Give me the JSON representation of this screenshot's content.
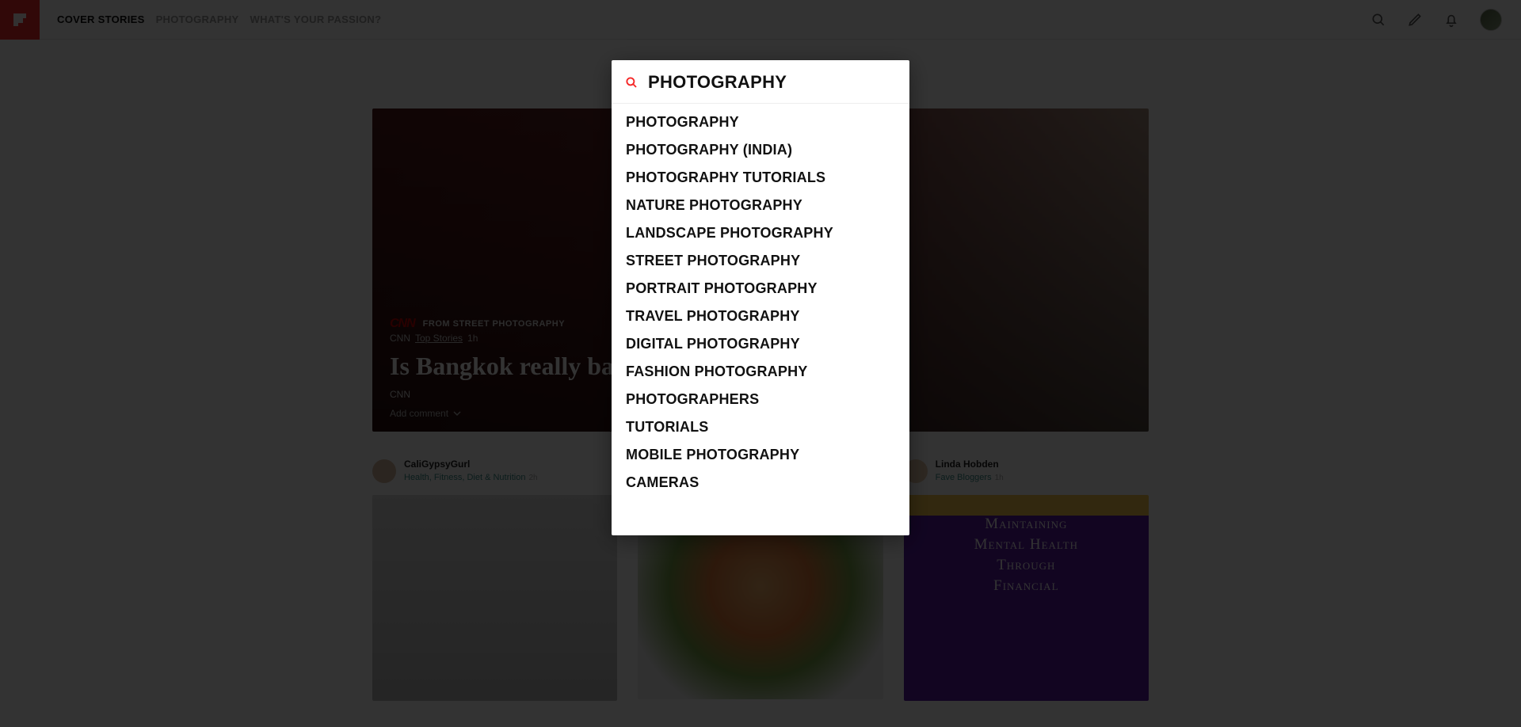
{
  "header": {
    "tabs": [
      "COVER STORIES",
      "PHOTOGRAPHY",
      "WHAT'S YOUR PASSION?"
    ],
    "active_tab": 0
  },
  "hero": {
    "kicker": "FROM STREET PHOTOGRAPHY",
    "source_short": "CNN",
    "source_section": "Top Stories",
    "age": "1h",
    "title": "Is Bangkok really banning its street food stalls?",
    "source": "CNN",
    "add_comment": "Add comment"
  },
  "cards": [
    {
      "author": "CaliGypsyGurl",
      "sub": "Health, Fitness, Diet & Nutrition",
      "age": "2h"
    },
    {
      "author": "",
      "sub": "",
      "age": ""
    },
    {
      "author": "Linda Hobden",
      "sub": "Fave Bloggers",
      "age": "1h",
      "tile_lines": [
        "Maintaining",
        "Mental Health",
        "Through",
        "Financial"
      ]
    }
  ],
  "search": {
    "query": "PHOTOGRAPHY",
    "suggestions": [
      "PHOTOGRAPHY",
      "PHOTOGRAPHY (INDIA)",
      "PHOTOGRAPHY TUTORIALS",
      "NATURE PHOTOGRAPHY",
      "LANDSCAPE PHOTOGRAPHY",
      "STREET PHOTOGRAPHY",
      "PORTRAIT PHOTOGRAPHY",
      "TRAVEL PHOTOGRAPHY",
      "DIGITAL PHOTOGRAPHY",
      "FASHION PHOTOGRAPHY",
      "PHOTOGRAPHERS",
      "TUTORIALS",
      "MOBILE PHOTOGRAPHY",
      "CAMERAS"
    ]
  }
}
